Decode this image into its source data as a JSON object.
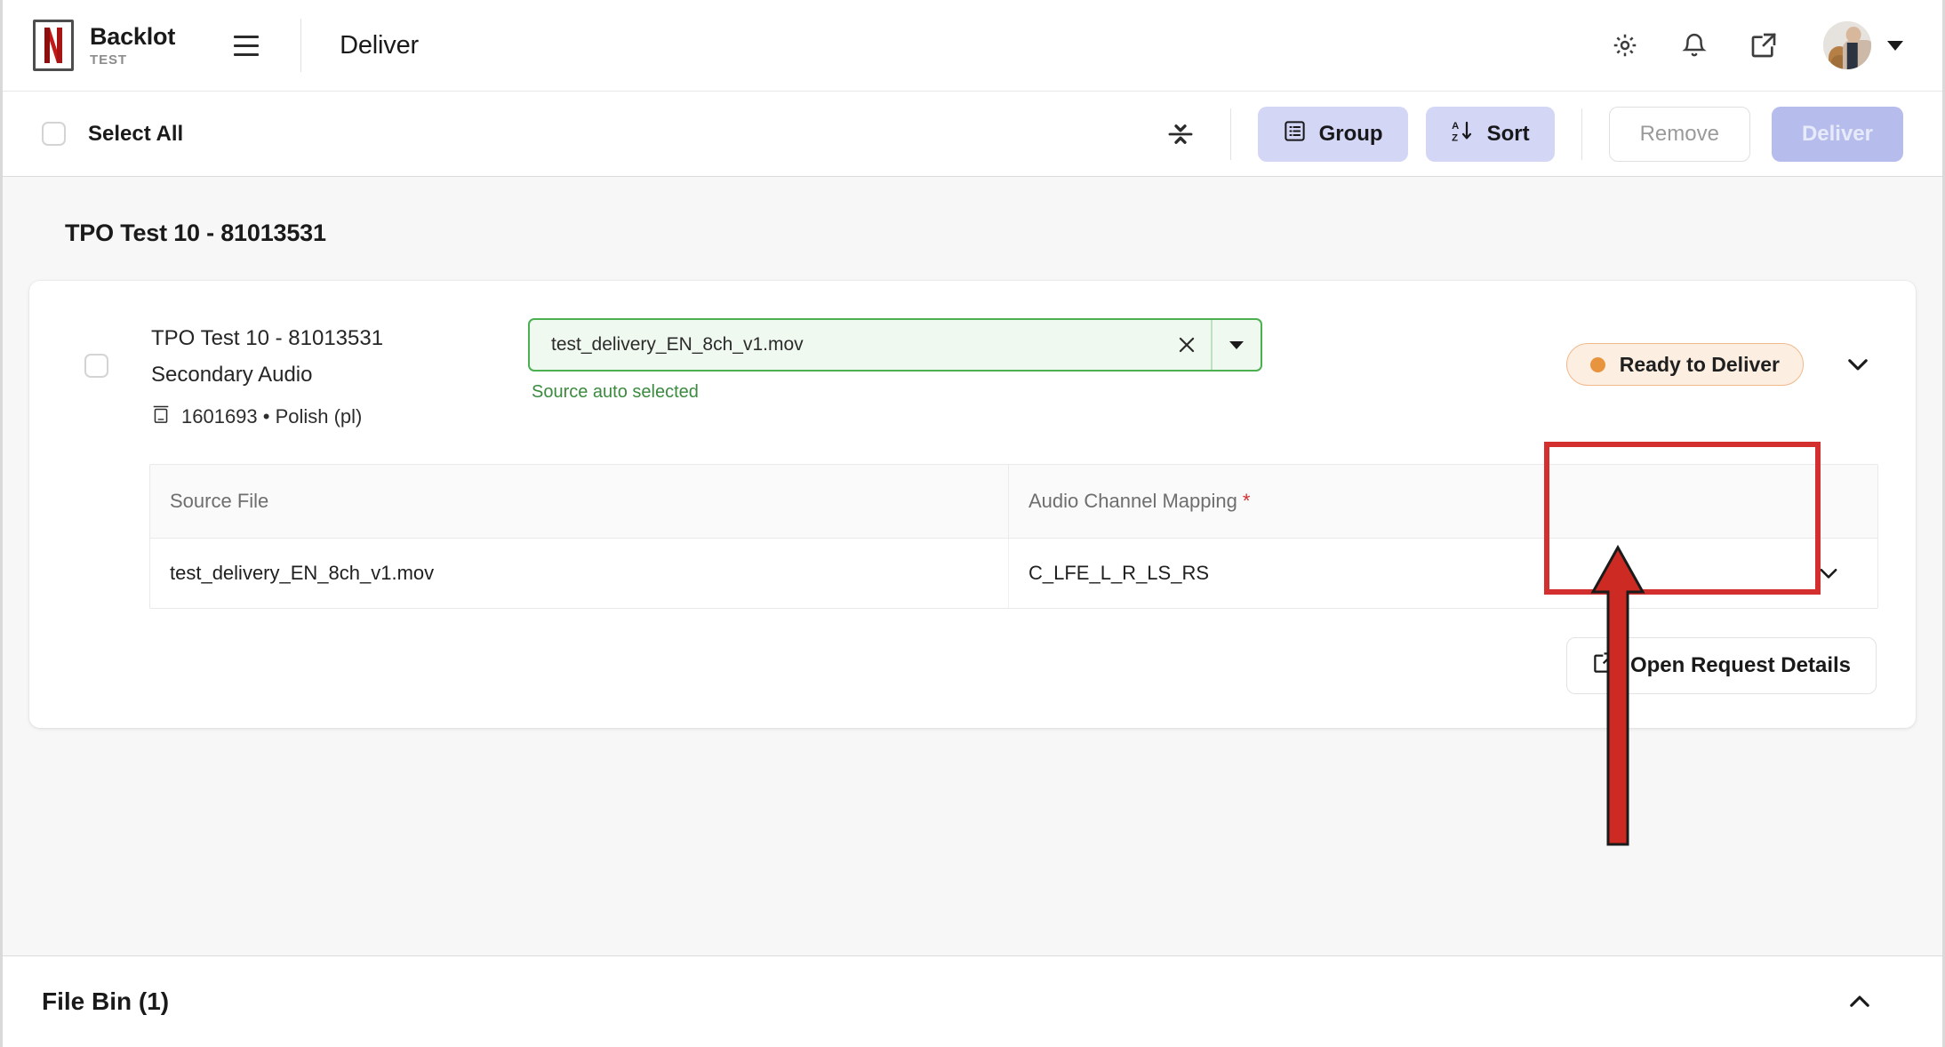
{
  "header": {
    "brand_name": "Backlot",
    "brand_sub": "TEST",
    "page_title": "Deliver",
    "menu_icon": "hamburger-icon",
    "settings_icon": "gear-icon",
    "notifications_icon": "bell-icon",
    "external_icon": "external-link-icon",
    "avatar_icon": "user-avatar",
    "avatar_caret_icon": "caret-down-icon"
  },
  "toolbar": {
    "select_all_label": "Select All",
    "collapse_icon": "collapse-expand-all-icon",
    "group_label": "Group",
    "group_icon": "list-icon",
    "sort_label": "Sort",
    "sort_icon": "sort-az-icon",
    "remove_label": "Remove",
    "deliver_label": "Deliver",
    "deliver_disabled": true
  },
  "main": {
    "group_title": "TPO Test 10 - 81013531",
    "row": {
      "title": "TPO Test 10 - 81013531",
      "subtitle": "Secondary Audio",
      "meta_icon": "asset-id-icon",
      "meta": "1601693 • Polish (pl)",
      "select_value": "test_delivery_EN_8ch_v1.mov",
      "select_clear_icon": "close-icon",
      "select_arrow_icon": "caret-down-icon",
      "select_help": "Source auto selected",
      "status_label": "Ready to Deliver",
      "status_color": "#e8943f",
      "status_bg": "#fdeee2",
      "row_chevron_icon": "chevron-down-icon"
    },
    "table": {
      "columns": [
        "Source File",
        "Audio Channel Mapping"
      ],
      "required_marker": "*",
      "rows": [
        {
          "source_file": "test_delivery_EN_8ch_v1.mov",
          "audio_channel_mapping": "C_LFE_L_R_LS_RS",
          "chevron_icon": "chevron-down-icon"
        }
      ]
    },
    "open_request_details_label": "Open Request Details",
    "open_request_details_icon": "external-link-icon"
  },
  "filebin": {
    "title": "File Bin (1)",
    "chevron_icon": "chevron-up-icon"
  },
  "annotations": {
    "highlight_color": "#d32f2f",
    "arrow_color": "#cc2a22",
    "target": "Ready to Deliver"
  }
}
